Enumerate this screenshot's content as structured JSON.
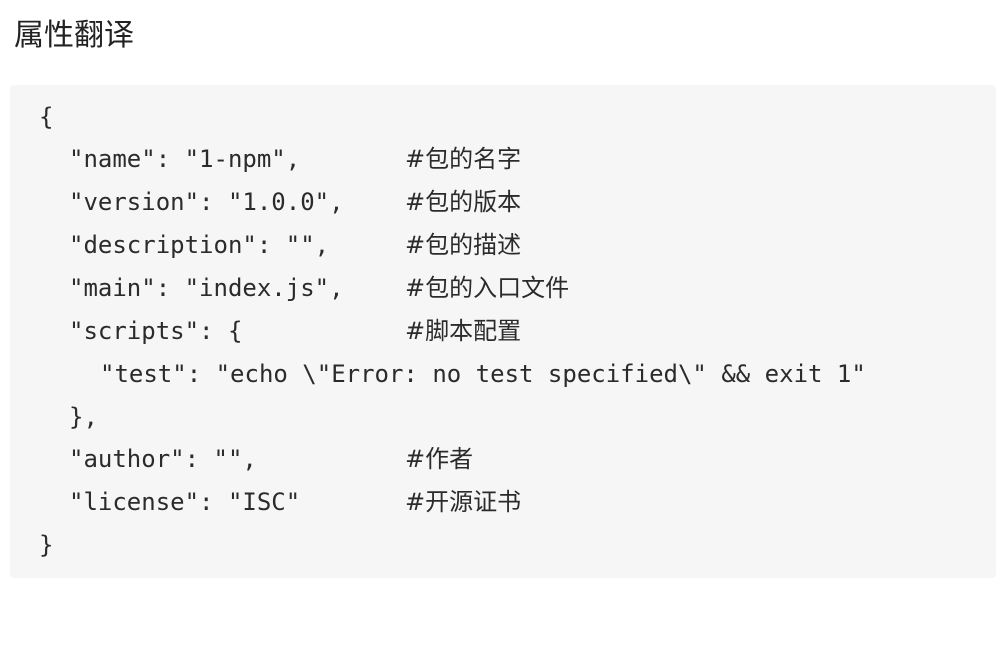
{
  "heading": "属性翻译",
  "code": {
    "lines": [
      {
        "code": "{",
        "comment": ""
      },
      {
        "code": "\"name\": \"1-npm\",",
        "comment": "#包的名字"
      },
      {
        "code": "\"version\": \"1.0.0\",",
        "comment": "#包的版本"
      },
      {
        "code": "\"description\": \"\",",
        "comment": "#包的描述"
      },
      {
        "code": "\"main\": \"index.js\",",
        "comment": "#包的入口文件"
      },
      {
        "code": "\"scripts\": {",
        "comment": "#脚本配置"
      },
      {
        "code": "\"test\": \"echo \\\"Error: no test specified\\\" && exit 1\"",
        "comment": ""
      },
      {
        "code": "},",
        "comment": ""
      },
      {
        "code": "\"author\": \"\",",
        "comment": "#作者"
      },
      {
        "code": "\"license\": \"ISC\"",
        "comment": "#开源证书"
      },
      {
        "code": "}",
        "comment": ""
      }
    ]
  }
}
